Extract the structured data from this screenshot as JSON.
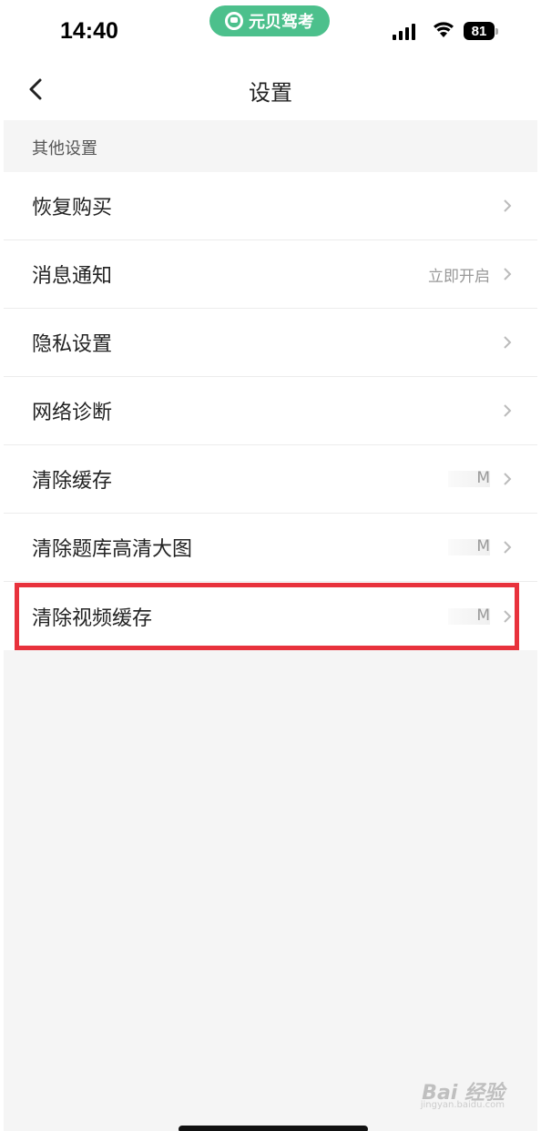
{
  "status_bar": {
    "time": "14:40",
    "app_pill_label": "元贝驾考",
    "battery": "81"
  },
  "nav": {
    "title": "设置"
  },
  "section": {
    "header": "其他设置"
  },
  "settings_items": [
    {
      "label": "恢复购买",
      "value": ""
    },
    {
      "label": "消息通知",
      "value": "立即开启"
    },
    {
      "label": "隐私设置",
      "value": ""
    },
    {
      "label": "网络诊断",
      "value": ""
    },
    {
      "label": "清除缓存",
      "value": "M"
    },
    {
      "label": "清除题库高清大图",
      "value": "M"
    },
    {
      "label": "清除视频缓存",
      "value": "M"
    }
  ],
  "watermark": {
    "brand": "Bai 经验",
    "url": "jingyan.baidu.com"
  },
  "colors": {
    "app_pill": "#4cc08c",
    "highlight": "#e8323c",
    "background": "#f5f5f5"
  }
}
